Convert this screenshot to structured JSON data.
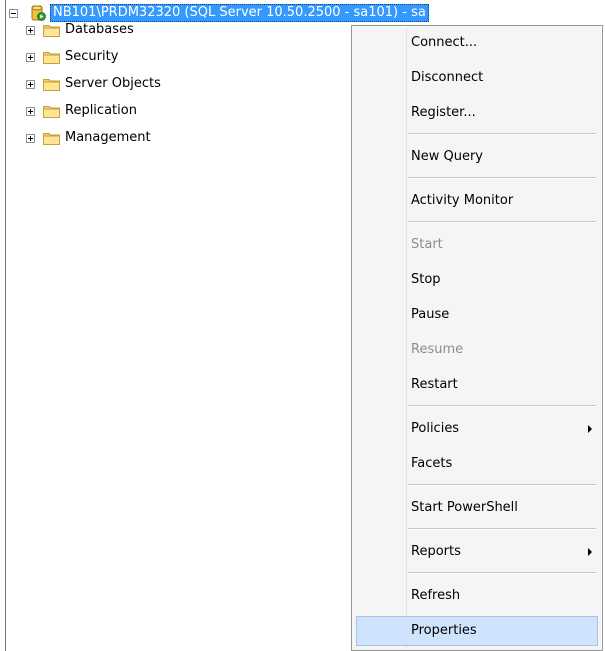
{
  "tree": {
    "server_label": "NB101\\PRDM32320 (SQL Server 10.50.2500 - sa101) - sa",
    "nodes": [
      {
        "label": "Databases"
      },
      {
        "label": "Security"
      },
      {
        "label": "Server Objects"
      },
      {
        "label": "Replication"
      },
      {
        "label": "Management"
      }
    ]
  },
  "context_menu": {
    "items": [
      {
        "label": "Connect...",
        "enabled": true
      },
      {
        "label": "Disconnect",
        "enabled": true
      },
      {
        "label": "Register...",
        "enabled": true
      },
      {
        "label": "New Query",
        "enabled": true
      },
      {
        "label": "Activity Monitor",
        "enabled": true
      },
      {
        "label": "Start",
        "enabled": false
      },
      {
        "label": "Stop",
        "enabled": true
      },
      {
        "label": "Pause",
        "enabled": true
      },
      {
        "label": "Resume",
        "enabled": false
      },
      {
        "label": "Restart",
        "enabled": true
      },
      {
        "label": "Policies",
        "enabled": true,
        "submenu": true
      },
      {
        "label": "Facets",
        "enabled": true
      },
      {
        "label": "Start PowerShell",
        "enabled": true
      },
      {
        "label": "Reports",
        "enabled": true,
        "submenu": true
      },
      {
        "label": "Refresh",
        "enabled": true
      },
      {
        "label": "Properties",
        "enabled": true,
        "highlighted": true
      }
    ]
  },
  "colors": {
    "selection": "#3399ff",
    "menu_background": "#f5f5f5",
    "menu_highlight": "#cfe3fc",
    "disabled_text": "#8d8d8d"
  }
}
